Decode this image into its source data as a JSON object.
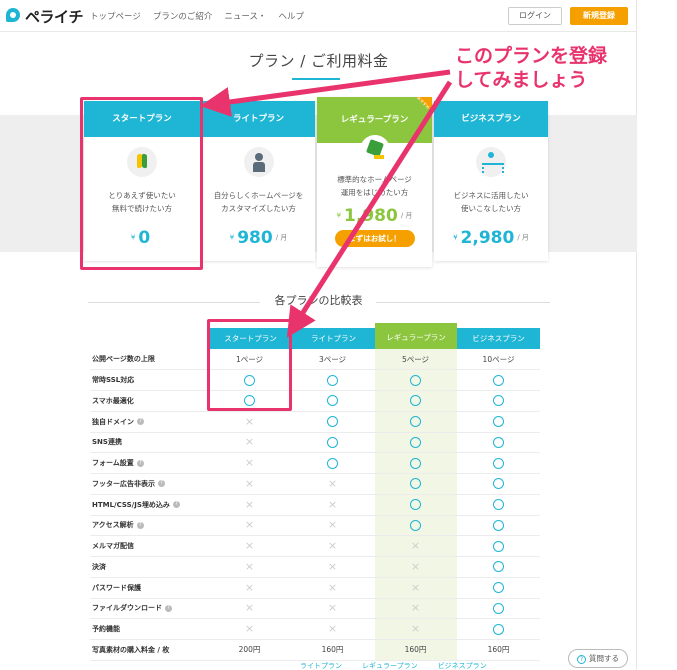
{
  "header": {
    "logo_text": "ペライチ",
    "nav": [
      "トップページ",
      "プランのご紹介",
      "ニュース・",
      "ヘルプ"
    ],
    "login_label": "ログイン",
    "register_label": "新規登録"
  },
  "page_title": "プラン / ご利用料金",
  "annotation": {
    "callout_line1": "このプランを登録",
    "callout_line2": "してみましょう",
    "accent_color": "#e8336d"
  },
  "plans": [
    {
      "name": "スタートプラン",
      "desc1": "とりあえず使いたい",
      "desc2": "無料で続けたい方",
      "yen": "¥",
      "price": "0",
      "per": "",
      "icon": "beginner-leaf-icon"
    },
    {
      "name": "ライトプラン",
      "desc1": "自分らしくホームページを",
      "desc2": "カスタマイズしたい方",
      "yen": "¥",
      "price": "980",
      "per": "/ 月",
      "icon": "person-thinking-icon"
    },
    {
      "name": "レギュラープラン",
      "desc1": "標準的なホームページ",
      "desc2": "運用をはじめたい方",
      "yen": "¥",
      "price": "1,980",
      "per": "/ 月",
      "icon": "running-person-icon",
      "ribbon": "おすすめ",
      "try_label": "まずはお試し！"
    },
    {
      "name": "ビジネスプラン",
      "desc1": "ビジネスに活用したい",
      "desc2": "使いこなしたい方",
      "yen": "¥",
      "price": "2,980",
      "per": "/ 月",
      "icon": "organization-icon"
    }
  ],
  "comparison": {
    "title": "各プランの比較表",
    "columns": [
      "スタートプラン",
      "ライトプラン",
      "レギュラープラン",
      "ビジネスプラン"
    ],
    "rows": [
      {
        "label": "公開ページ数の上限",
        "help": false,
        "values": [
          "1ページ",
          "3ページ",
          "5ページ",
          "10ページ"
        ]
      },
      {
        "label": "常時SSL対応",
        "help": false,
        "values": [
          "o",
          "o",
          "o",
          "o"
        ]
      },
      {
        "label": "スマホ最適化",
        "help": false,
        "values": [
          "o",
          "o",
          "o",
          "o"
        ]
      },
      {
        "label": "独自ドメイン",
        "help": true,
        "values": [
          "x",
          "o",
          "o",
          "o"
        ]
      },
      {
        "label": "SNS連携",
        "help": false,
        "values": [
          "x",
          "o",
          "o",
          "o"
        ]
      },
      {
        "label": "フォーム設置",
        "help": true,
        "values": [
          "x",
          "o",
          "o",
          "o"
        ]
      },
      {
        "label": "フッター広告非表示",
        "help": true,
        "values": [
          "x",
          "x",
          "o",
          "o"
        ]
      },
      {
        "label": "HTML/CSS/JS埋め込み",
        "help": true,
        "values": [
          "x",
          "x",
          "o",
          "o"
        ]
      },
      {
        "label": "アクセス解析",
        "help": true,
        "values": [
          "x",
          "x",
          "o",
          "o"
        ]
      },
      {
        "label": "メルマガ配信",
        "help": false,
        "values": [
          "x",
          "x",
          "x",
          "o"
        ]
      },
      {
        "label": "決済",
        "help": false,
        "values": [
          "x",
          "x",
          "x",
          "o"
        ]
      },
      {
        "label": "パスワード保護",
        "help": false,
        "values": [
          "x",
          "x",
          "x",
          "o"
        ]
      },
      {
        "label": "ファイルダウンロード",
        "help": true,
        "values": [
          "x",
          "x",
          "x",
          "o"
        ]
      },
      {
        "label": "予約機能",
        "help": false,
        "values": [
          "x",
          "x",
          "x",
          "o"
        ]
      },
      {
        "label": "写真素材の購入料金 / 枚",
        "help": false,
        "values": [
          "200円",
          "160円",
          "160円",
          "160円"
        ]
      }
    ],
    "bottom_links": [
      "ライトプラン",
      "レギュラープラン",
      "ビジネスプラン"
    ]
  },
  "help_button_label": "質問する",
  "colors": {
    "primary": "#1fb5d4",
    "regular": "#8cc63f",
    "orange": "#f6a000"
  }
}
